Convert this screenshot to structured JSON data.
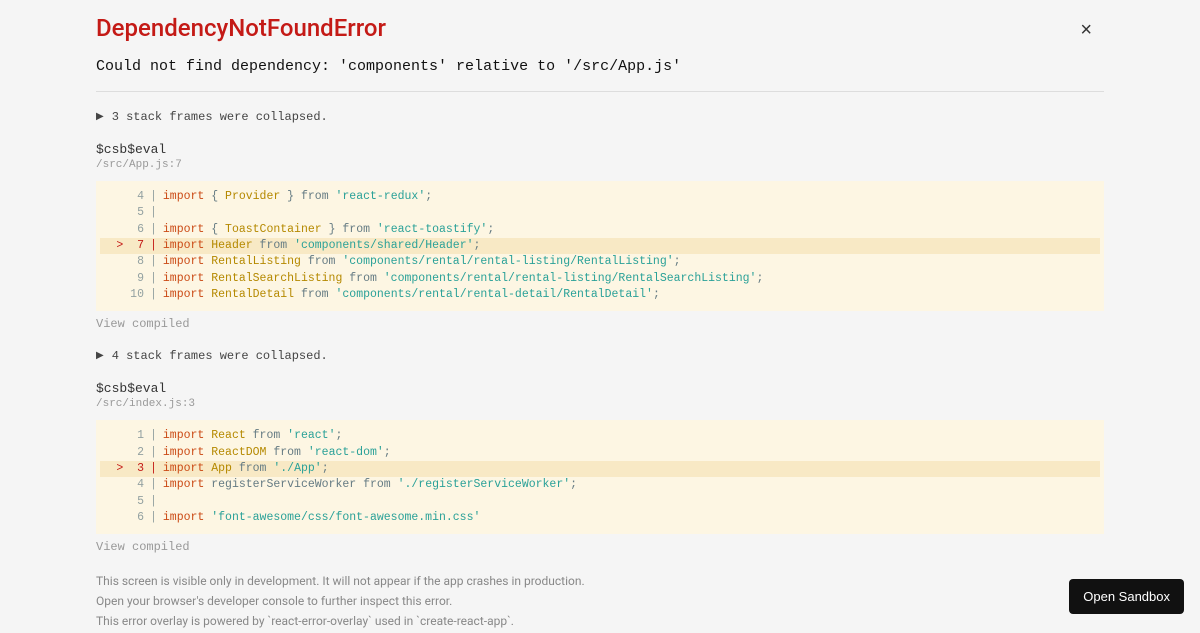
{
  "error": {
    "title": "DependencyNotFoundError",
    "message": "Could not find dependency: 'components' relative to '/src/App.js'"
  },
  "close_label": "×",
  "collapse1": "3 stack frames were collapsed.",
  "collapse2": "4 stack frames were collapsed.",
  "frame1": {
    "name": "$csb$eval",
    "location": "/src/App.js:7"
  },
  "frame2": {
    "name": "$csb$eval",
    "location": "/src/index.js:3"
  },
  "view_compiled": "View compiled",
  "code1": {
    "l4": {
      "num": "  4",
      "import": "import",
      "brace_o": " { ",
      "ident": "Provider",
      "brace_c": " } ",
      "from": "from ",
      "str": "'react-redux'",
      "semi": ";"
    },
    "l5": {
      "num": "  5"
    },
    "l6": {
      "num": "  6",
      "import": "import",
      "brace_o": " { ",
      "ident": "ToastContainer",
      "brace_c": " } ",
      "from": "from ",
      "str": "'react-toastify'",
      "semi": ";"
    },
    "l7": {
      "num": ">  7",
      "import": "import",
      "sp": " ",
      "ident": "Header",
      "from": " from ",
      "str": "'components/shared/Header'",
      "semi": ";"
    },
    "l8": {
      "num": "  8",
      "import": "import",
      "sp": " ",
      "ident": "RentalListing",
      "from": " from ",
      "str": "'components/rental/rental-listing/RentalListing'",
      "semi": ";"
    },
    "l9": {
      "num": "  9",
      "import": "import",
      "sp": " ",
      "ident": "RentalSearchListing",
      "from": " from ",
      "str": "'components/rental/rental-listing/RentalSearchListing'",
      "semi": ";"
    },
    "l10": {
      "num": " 10",
      "import": "import",
      "sp": " ",
      "ident": "RentalDetail",
      "from": " from ",
      "str": "'components/rental/rental-detail/RentalDetail'",
      "semi": ";"
    }
  },
  "code2": {
    "l1": {
      "num": "  1",
      "import": "import",
      "sp": " ",
      "ident": "React",
      "from": " from ",
      "str": "'react'",
      "semi": ";"
    },
    "l2": {
      "num": "  2",
      "import": "import",
      "sp": " ",
      "ident": "ReactDOM",
      "from": " from ",
      "str": "'react-dom'",
      "semi": ";"
    },
    "l3": {
      "num": ">  3",
      "import": "import",
      "sp": " ",
      "ident": "App",
      "from": " from ",
      "str": "'./App'",
      "semi": ";"
    },
    "l4": {
      "num": "  4",
      "import": "import",
      "sp": " ",
      "ident_plain": "registerServiceWorker",
      "from": " from ",
      "str": "'./registerServiceWorker'",
      "semi": ";"
    },
    "l5": {
      "num": "  5"
    },
    "l6": {
      "num": "  6",
      "import": "import",
      "sp": " ",
      "str": "'font-awesome/css/font-awesome.min.css'"
    }
  },
  "footer": {
    "line1": "This screen is visible only in development. It will not appear if the app crashes in production.",
    "line2": "Open your browser's developer console to further inspect this error.",
    "line3": "This error overlay is powered by `react-error-overlay` used in `create-react-app`."
  },
  "open_sandbox": "Open Sandbox"
}
